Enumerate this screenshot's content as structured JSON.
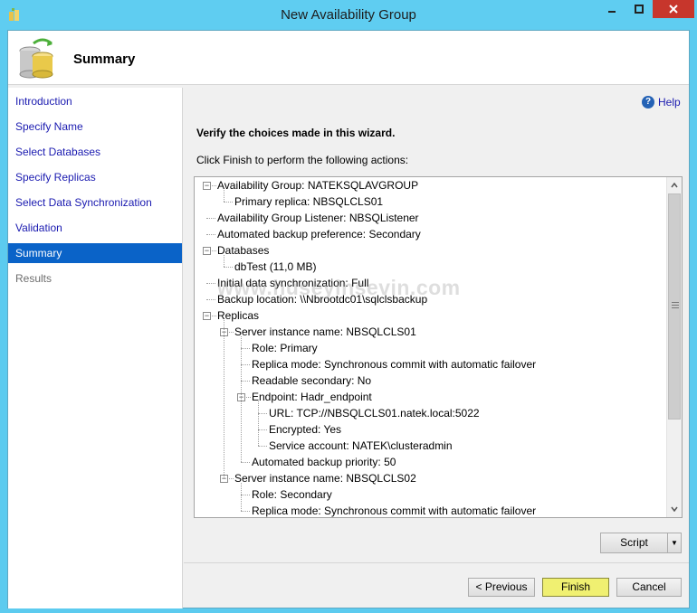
{
  "window": {
    "title": "New Availability Group"
  },
  "header": {
    "title": "Summary"
  },
  "nav": {
    "items": [
      {
        "label": "Introduction",
        "state": "normal"
      },
      {
        "label": "Specify Name",
        "state": "normal"
      },
      {
        "label": "Select Databases",
        "state": "normal"
      },
      {
        "label": "Specify Replicas",
        "state": "normal"
      },
      {
        "label": "Select Data Synchronization",
        "state": "normal"
      },
      {
        "label": "Validation",
        "state": "normal"
      },
      {
        "label": "Summary",
        "state": "active"
      },
      {
        "label": "Results",
        "state": "disabled"
      }
    ]
  },
  "content": {
    "help_label": "Help",
    "verify_text": "Verify the choices made in this wizard.",
    "instructions": "Click Finish to perform the following actions:"
  },
  "tree": [
    {
      "level": 0,
      "text": "Availability Group: NATEKSQLAVGROUP",
      "expander": "minus"
    },
    {
      "level": 1,
      "text": "Primary replica: NBSQLCLS01",
      "expander": "none"
    },
    {
      "level": 0,
      "text": "Availability Group Listener: NBSQListener",
      "expander": "none"
    },
    {
      "level": 0,
      "text": "Automated backup preference: Secondary",
      "expander": "none"
    },
    {
      "level": 0,
      "text": "Databases",
      "expander": "minus"
    },
    {
      "level": 1,
      "text": "dbTest (11,0 MB)",
      "expander": "none"
    },
    {
      "level": 0,
      "text": "Initial data synchronization: Full",
      "expander": "none"
    },
    {
      "level": 0,
      "text": "Backup location: \\\\Nbrootdc01\\sqlclsbackup",
      "expander": "none"
    },
    {
      "level": 0,
      "text": "Replicas",
      "expander": "minus"
    },
    {
      "level": 1,
      "text": "Server instance name: NBSQLCLS01",
      "expander": "minus"
    },
    {
      "level": 2,
      "text": "Role: Primary",
      "expander": "none"
    },
    {
      "level": 2,
      "text": "Replica mode: Synchronous commit with automatic failover",
      "expander": "none"
    },
    {
      "level": 2,
      "text": "Readable secondary: No",
      "expander": "none"
    },
    {
      "level": 2,
      "text": "Endpoint: Hadr_endpoint",
      "expander": "minus"
    },
    {
      "level": 3,
      "text": "URL: TCP://NBSQLCLS01.natek.local:5022",
      "expander": "none"
    },
    {
      "level": 3,
      "text": "Encrypted: Yes",
      "expander": "none"
    },
    {
      "level": 3,
      "text": "Service account: NATEK\\clusteradmin",
      "expander": "none"
    },
    {
      "level": 2,
      "text": "Automated backup priority: 50",
      "expander": "none"
    },
    {
      "level": 1,
      "text": "Server instance name: NBSQLCLS02",
      "expander": "minus"
    },
    {
      "level": 2,
      "text": "Role: Secondary",
      "expander": "none"
    },
    {
      "level": 2,
      "text": "Replica mode: Synchronous commit with automatic failover",
      "expander": "none"
    }
  ],
  "buttons": {
    "script": "Script",
    "previous": "< Previous",
    "finish": "Finish",
    "cancel": "Cancel"
  },
  "watermark": "www.huseyinsevin.com",
  "colors": {
    "titlebar": "#5fcdf1",
    "nav_active": "#0a63c8",
    "link": "#1a1ab0",
    "finish_highlight": "#f0f071",
    "close_button": "#c7362c"
  }
}
